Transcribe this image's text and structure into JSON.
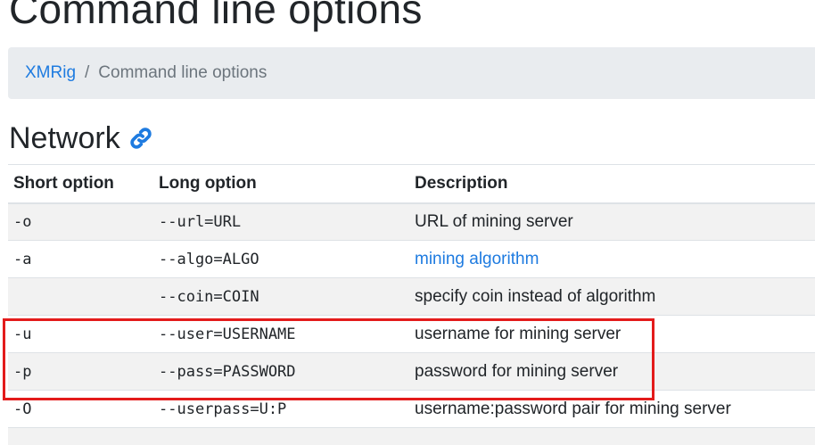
{
  "page": {
    "title": "Command line options"
  },
  "breadcrumb": {
    "home_label": "XMRig",
    "separator": "/",
    "current_label": "Command line options"
  },
  "section": {
    "heading": "Network",
    "link_icon": "link-icon"
  },
  "table": {
    "headers": {
      "short": "Short option",
      "long": "Long option",
      "description": "Description"
    },
    "rows": [
      {
        "short": "-o",
        "long": "--url=URL",
        "description": "URL of mining server",
        "description_is_link": false
      },
      {
        "short": "-a",
        "long": "--algo=ALGO",
        "description": "mining algorithm",
        "description_is_link": true
      },
      {
        "short": "",
        "long": "--coin=COIN",
        "description": "specify coin instead of algorithm",
        "description_is_link": false
      },
      {
        "short": "-u",
        "long": "--user=USERNAME",
        "description": "username for mining server",
        "description_is_link": false
      },
      {
        "short": "-p",
        "long": "--pass=PASSWORD",
        "description": "password for mining server",
        "description_is_link": false
      },
      {
        "short": "-O",
        "long": "--userpass=U:P",
        "description": "username:password pair for mining server",
        "description_is_link": false
      },
      {
        "short": "",
        "long": "",
        "description": "",
        "description_is_link": false
      }
    ]
  },
  "colors": {
    "link": "#1e7be0",
    "highlight_border": "#e31b1b",
    "breadcrumb_bg": "#e9ecef",
    "stripe_bg": "#f2f2f2"
  }
}
